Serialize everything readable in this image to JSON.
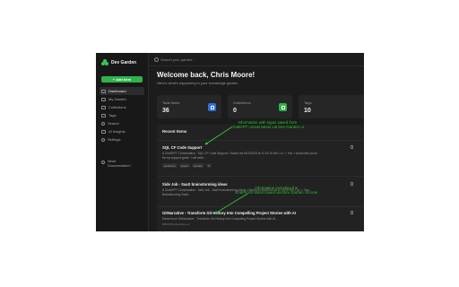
{
  "app": {
    "name": "Dev Garden"
  },
  "sidebar": {
    "add_button": "+ Add Item",
    "items": [
      {
        "label": "Dashboard",
        "icon": "home-icon",
        "active": true
      },
      {
        "label": "My Garden",
        "icon": "grid-icon"
      },
      {
        "label": "Collections",
        "icon": "folder-icon"
      },
      {
        "label": "Tags",
        "icon": "tag-icon"
      },
      {
        "label": "Search",
        "icon": "search-icon"
      },
      {
        "label": "AI Insights",
        "icon": "sparkle-icon"
      },
      {
        "label": "Settings",
        "icon": "gear-icon"
      }
    ],
    "user": {
      "line1": "Never",
      "line2": "Documentation?"
    }
  },
  "search": {
    "placeholder": "Search your garden..."
  },
  "header": {
    "title": "Welcome back, Chris Moore!",
    "subtitle": "Here's what's happening in your knowledge garden"
  },
  "stats": [
    {
      "label": "Total Items",
      "value": "36",
      "icon": "document-icon",
      "color": "#2f6fde"
    },
    {
      "label": "Collections",
      "value": "0",
      "icon": "folder-icon",
      "color": "#2fb34a"
    },
    {
      "label": "Tags",
      "value": "10",
      "icon": "tag-icon",
      "color": "#2fb34a"
    }
  ],
  "recent": {
    "title": "Recent Items",
    "items": [
      {
        "title": "SQL CF Code Support",
        "desc": "A ChatGPT Conversation : SQL CF Code Support • Saved via 8/10/2025 at 11:13:19 AM • ••• ✓ You: I would like you to",
        "desc2": "be my support guide. I will write...",
        "tags": [
          "javascript",
          "speed",
          "sparkle",
          "Tt"
        ]
      },
      {
        "title": "Side Job - SaaS brainstorming ideas",
        "desc": "A ChatGPT Conversation : Side Job - SaaS brainstorming ideas • Saved on 8/8/2025 at 11:14:00 PM • ••• ✓ You:",
        "desc2": "Brainstorming SaaS..."
      },
      {
        "title": "GitNarrative - Transform Git History Into Compelling Project Stories with AI",
        "desc": "Saved from GitNarrative - Transform Git History into Compelling Project Stories with AI...",
        "meta": "8/8/2025   gitnarrative.ai"
      }
    ]
  },
  "annotations": {
    "a1_line1": "Information with logos saved from",
    "a1_line2": "ChatGPT conversation via Dev Garden ui",
    "a2_line1": "Information including the",
    "a2_line2": "Grid/Profit Stack saved via Dev Garden chrome"
  },
  "colors": {
    "accent": "#2fb34a",
    "annotation": "#36d33a",
    "blue": "#2f6fde"
  }
}
